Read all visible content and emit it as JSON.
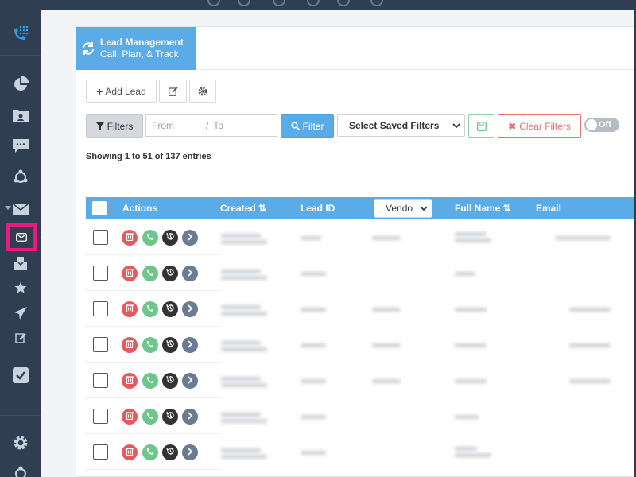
{
  "header": {
    "title": "Lead Management",
    "subtitle": "Call, Plan, & Track"
  },
  "toolbar": {
    "add_lead_label": "Add Lead",
    "filters_label": "Filters",
    "from_placeholder": "From",
    "to_placeholder": "To",
    "range_separator": "/",
    "filter_button_label": "Filter",
    "saved_filters_label": "Select Saved Filters",
    "clear_filters_label": "Clear Filters",
    "toggle_label": "Off"
  },
  "summary": {
    "showing_text": "Showing 1 to 51 of 137 entries"
  },
  "table": {
    "columns": [
      "Actions",
      "Created ⇅",
      "Lead ID",
      "Vendor",
      "Full Name ⇅",
      "Email"
    ],
    "vendor_select_value": "Vendo",
    "row_count_visible": 7
  },
  "colors": {
    "accent": "#5aabe6",
    "highlight": "#ec1780",
    "sidebar": "#2f3f51",
    "delete": "#e55a5a",
    "call": "#6dc68a",
    "history": "#333333",
    "open": "#6b7b92"
  }
}
